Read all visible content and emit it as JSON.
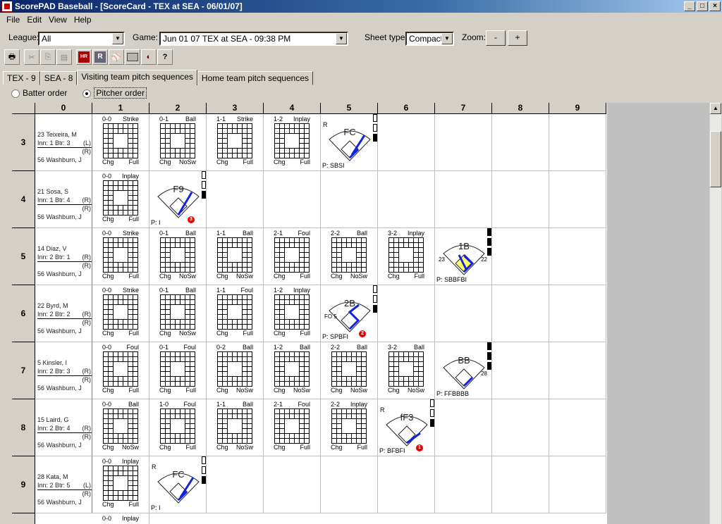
{
  "window": {
    "title": "ScorePAD Baseball - [ScoreCard - TEX at SEA - 06/01/07]"
  },
  "menu": [
    "File",
    "Edit",
    "View",
    "Help"
  ],
  "filters": {
    "league_label": "League:",
    "league_value": "All",
    "game_label": "Game:",
    "game_value": "Jun 01 07  TEX at SEA - 09:38 PM",
    "sheet_label": "Sheet type:",
    "sheet_value": "Compact",
    "zoom_label": "Zoom:",
    "zoom_out": "-",
    "zoom_in": "+"
  },
  "toolbar_icons": [
    "print-icon",
    "cut-icon",
    "copy-icon",
    "paste-icon",
    "home-run-icon",
    "runner-icon",
    "batter-icon",
    "field-icon",
    "glove-icon",
    "help-icon"
  ],
  "tabs": [
    "TEX - 9",
    "SEA - 8",
    "Visiting team pitch sequences",
    "Home team pitch sequences"
  ],
  "order": {
    "batter": "Batter order",
    "pitcher": "Pitcher order"
  },
  "columns": [
    "0",
    "1",
    "2",
    "3",
    "4",
    "5",
    "6",
    "7",
    "8",
    "9"
  ],
  "rows": [
    {
      "num": "3",
      "name": "23 Teixeira, M",
      "info": "Inn: 1  Btr: 3",
      "hand1": "(L)",
      "hand2": "(R)",
      "pitcher": "56 Washburn, J",
      "pitches": [
        {
          "count": "0-0",
          "result": "Strike",
          "b1": "Chg",
          "b2": "Full"
        },
        {
          "count": "0-1",
          "result": "Ball",
          "b1": "Chg",
          "b2": "NoSw"
        },
        {
          "count": "1-1",
          "result": "Strike",
          "b1": "Chg",
          "b2": "Full"
        },
        {
          "count": "1-2",
          "result": "Inplay",
          "b1": "Chg",
          "b2": "Full"
        }
      ],
      "play": {
        "label": "FC",
        "seq": "P: SBSI",
        "r": "R"
      }
    },
    {
      "num": "4",
      "name": "21 Sosa, S",
      "info": "Inn: 1  Btr: 4",
      "hand1": "(R)",
      "hand2": "(R)",
      "pitcher": "56 Washburn, J",
      "pitches": [
        {
          "count": "0-0",
          "result": "Inplay",
          "b1": "Chg",
          "b2": "Full"
        }
      ],
      "play": {
        "label": "F9",
        "seq": "P: I",
        "r": "",
        "out": "3"
      }
    },
    {
      "num": "5",
      "name": "14 Diaz, V",
      "info": "Inn: 2  Btr: 1",
      "hand1": "(R)",
      "hand2": "(R)",
      "pitcher": "56 Washburn, J",
      "pitches": [
        {
          "count": "0-0",
          "result": "Strike",
          "b1": "Chg",
          "b2": "Full"
        },
        {
          "count": "0-1",
          "result": "Ball",
          "b1": "Chg",
          "b2": "NoSw"
        },
        {
          "count": "1-1",
          "result": "Ball",
          "b1": "Chg",
          "b2": "NoSw"
        },
        {
          "count": "2-1",
          "result": "Foul",
          "b1": "Chg",
          "b2": "Full"
        },
        {
          "count": "2-2",
          "result": "Ball",
          "b1": "Chg",
          "b2": "NoSw"
        },
        {
          "count": "3-2",
          "result": "Inplay",
          "b1": "Chg",
          "b2": "Full"
        }
      ],
      "play": {
        "label": "1B",
        "seq": "P: SBBFBI",
        "r": "",
        "n1": "23",
        "n2": "22"
      }
    },
    {
      "num": "6",
      "name": "22 Byrd, M",
      "info": "Inn: 2  Btr: 2",
      "hand1": "(R)",
      "hand2": "(R)",
      "pitcher": "56 Washburn, J",
      "pitches": [
        {
          "count": "0-0",
          "result": "Strike",
          "b1": "Chg",
          "b2": "Full"
        },
        {
          "count": "0-1",
          "result": "Ball",
          "b1": "Chg",
          "b2": "NoSw"
        },
        {
          "count": "1-1",
          "result": "Foul",
          "b1": "Chg",
          "b2": "Full"
        },
        {
          "count": "1-2",
          "result": "Inplay",
          "b1": "Chg",
          "b2": "Full"
        }
      ],
      "play": {
        "label": "2B",
        "seq": "P: SPBFI",
        "r": "",
        "n1": "FO 5",
        "out": "2"
      }
    },
    {
      "num": "7",
      "name": "5 Kinsler, I",
      "info": "Inn: 2  Btr: 3",
      "hand1": "(R)",
      "hand2": "(R)",
      "pitcher": "56 Washburn, J",
      "pitches": [
        {
          "count": "0-0",
          "result": "Foul",
          "b1": "Chg",
          "b2": "Full"
        },
        {
          "count": "0-1",
          "result": "Foul",
          "b1": "Chg",
          "b2": "Full"
        },
        {
          "count": "0-2",
          "result": "Ball",
          "b1": "Chg",
          "b2": "NoSw"
        },
        {
          "count": "1-2",
          "result": "Ball",
          "b1": "Chg",
          "b2": "NoSw"
        },
        {
          "count": "2-2",
          "result": "Ball",
          "b1": "Chg",
          "b2": "NoSw"
        },
        {
          "count": "3-2",
          "result": "Ball",
          "b1": "Chg",
          "b2": "NoSw"
        }
      ],
      "play": {
        "label": "BB",
        "seq": "P: FFBBBB",
        "r": "",
        "n2": "28"
      }
    },
    {
      "num": "8",
      "name": "15 Laird, G",
      "info": "Inn: 2  Btr: 4",
      "hand1": "(R)",
      "hand2": "(R)",
      "pitcher": "56 Washburn, J",
      "pitches": [
        {
          "count": "0-0",
          "result": "Ball",
          "b1": "Chg",
          "b2": "NoSw"
        },
        {
          "count": "1-0",
          "result": "Foul",
          "b1": "Chg",
          "b2": "Full"
        },
        {
          "count": "1-1",
          "result": "Ball",
          "b1": "Chg",
          "b2": "NoSw"
        },
        {
          "count": "2-1",
          "result": "Foul",
          "b1": "Chg",
          "b2": "Full"
        },
        {
          "count": "2-2",
          "result": "Inplay",
          "b1": "Chg",
          "b2": "Full"
        }
      ],
      "play": {
        "label": "fF3",
        "seq": "P: BFBFI",
        "r": "R",
        "out": "1"
      }
    },
    {
      "num": "9",
      "name": "28 Kata, M",
      "info": "Inn: 2  Btr: 5",
      "hand1": "(L)",
      "hand2": "(R)",
      "pitcher": "56 Washburn, J",
      "pitches": [
        {
          "count": "0-0",
          "result": "Inplay",
          "b1": "Chg",
          "b2": "Full"
        }
      ],
      "play": {
        "label": "FC",
        "seq": "P: I",
        "r": "R"
      }
    }
  ],
  "next_row": {
    "count": "0-0",
    "result": "Inplay"
  }
}
